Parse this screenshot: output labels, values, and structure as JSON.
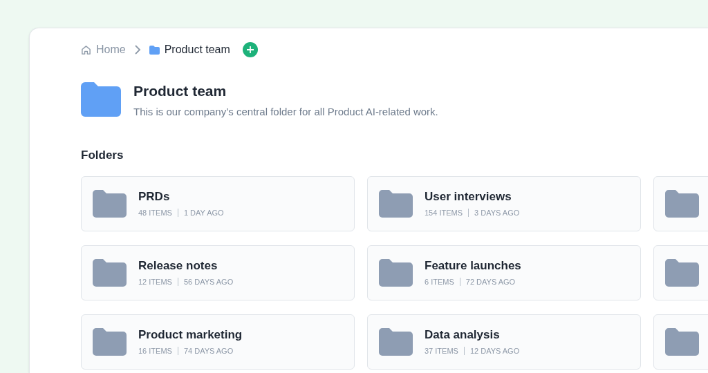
{
  "breadcrumb": [
    {
      "kind": "home",
      "label": "Home"
    },
    {
      "kind": "folder",
      "label": "Product team"
    }
  ],
  "header": {
    "title": "Product team",
    "description": "This is our company’s central folder for all Product AI-related work."
  },
  "section_title": "Folders",
  "folders": [
    {
      "kind": "card",
      "name": "PRDs",
      "items": "48 ITEMS",
      "updated": "1 DAY AGO"
    },
    {
      "kind": "card",
      "name": "User interviews",
      "items": "154 ITEMS",
      "updated": "3 DAYS AGO"
    },
    {
      "kind": "cut"
    },
    {
      "kind": "card",
      "name": "Release notes",
      "items": "12 ITEMS",
      "updated": "56 DAYS AGO"
    },
    {
      "kind": "card",
      "name": "Feature launches",
      "items": "6 ITEMS",
      "updated": "72 DAYS AGO"
    },
    {
      "kind": "cut"
    },
    {
      "kind": "card",
      "name": "Product marketing",
      "items": "16 ITEMS",
      "updated": "74 DAYS AGO"
    },
    {
      "kind": "card",
      "name": "Data analysis",
      "items": "37 ITEMS",
      "updated": "12 DAYS AGO"
    },
    {
      "kind": "cut"
    }
  ]
}
